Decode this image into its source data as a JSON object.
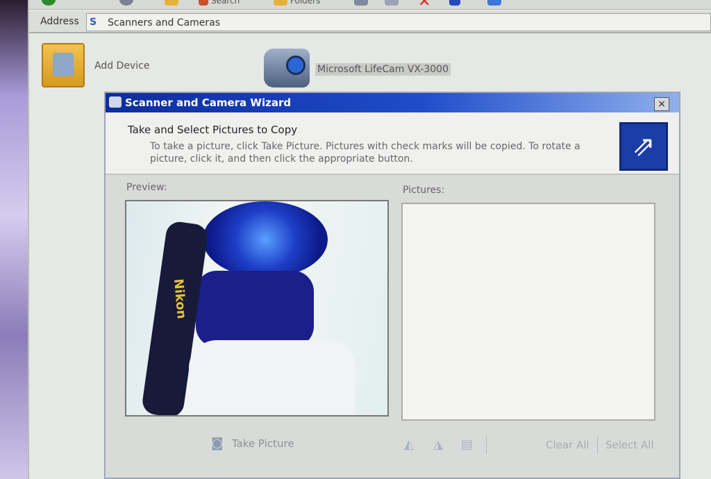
{
  "toolbar": {
    "search_label": "Search",
    "folders_label": "Folders"
  },
  "address": {
    "label": "Address",
    "value": "Scanners and Cameras"
  },
  "devices": [
    {
      "label": "Add Device",
      "icon": "scanner-camera-icon"
    },
    {
      "label": "Microsoft LifeCam VX-3000",
      "icon": "webcam-icon"
    }
  ],
  "wizard": {
    "title": "Scanner and Camera Wizard",
    "close": "×",
    "heading": "Take and Select Pictures to Copy",
    "description": "To take a picture, click Take Picture. Pictures with check marks will be copied. To rotate a picture, click it, and then click the appropriate button.",
    "preview_label": "Preview:",
    "pictures_label": "Pictures:",
    "take_picture": "Take Picture",
    "clear_all": "Clear All",
    "select_all": "Select All",
    "preview_strap_text": "Nikon"
  }
}
